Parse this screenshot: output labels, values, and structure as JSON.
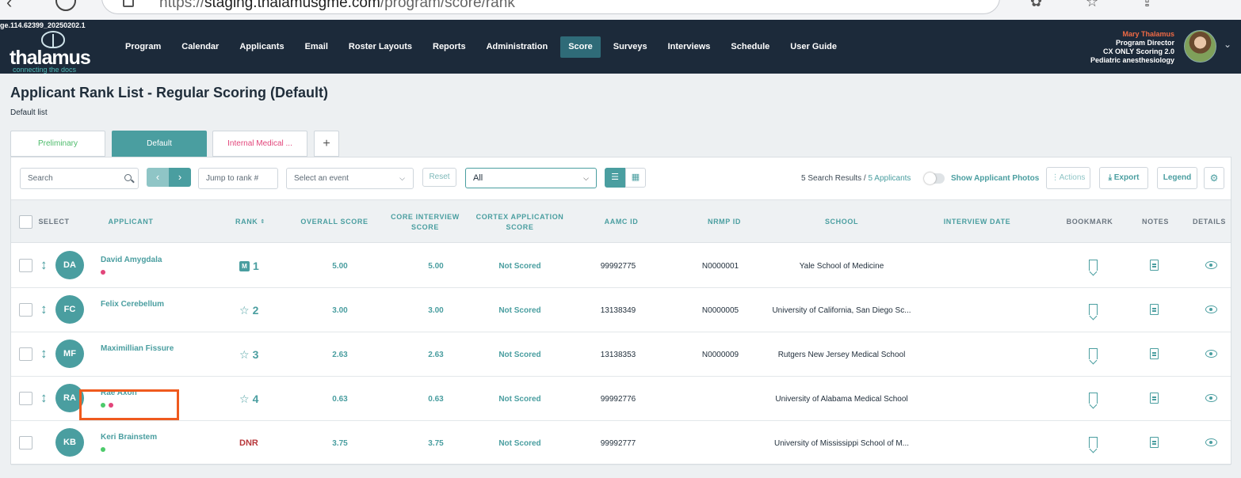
{
  "browser": {
    "url_prefix": "https://",
    "url_domain": "staging.thalamusgme.com",
    "url_path": "/program/score/rank"
  },
  "header": {
    "version": "ge.114.62399_20250202.1",
    "logo_text": "thalamus",
    "logo_tagline": "connecting the docs",
    "nav": [
      "Program",
      "Calendar",
      "Applicants",
      "Email",
      "Roster Layouts",
      "Reports",
      "Administration",
      "Score",
      "Surveys",
      "Interviews",
      "Schedule",
      "User Guide"
    ],
    "active_nav": "Score",
    "user": {
      "name": "Mary Thalamus",
      "role": "Program Director",
      "program": "CX ONLY Scoring 2.0",
      "specialty": "Pediatric anesthesiology"
    }
  },
  "page": {
    "title": "Applicant Rank List - Regular Scoring (Default)",
    "subtitle": "Default list",
    "tabs": [
      {
        "label": "Preliminary"
      },
      {
        "label": "Default"
      },
      {
        "label": "Internal Medical ..."
      }
    ],
    "add_tab_label": "+"
  },
  "toolbar": {
    "search_placeholder": "Search",
    "jump_placeholder": "Jump to rank #",
    "event_placeholder": "Select an event",
    "reset_label": "Reset",
    "filter_value": "All",
    "results_count": "5 Search Results",
    "results_sep": " / ",
    "results_applicants": "5 Applicants",
    "show_photos_label": "Show Applicant Photos",
    "actions_label": "Actions",
    "export_label": "Export",
    "legend_label": "Legend"
  },
  "table": {
    "headers": {
      "select": "SELECT",
      "applicant": "APPLICANT",
      "rank": "RANK",
      "overall": "OVERALL SCORE",
      "core": "CORE INTERVIEW SCORE",
      "cortex": "CORTEX APPLICATION SCORE",
      "aamc": "AAMC ID",
      "nrmp": "NRMP ID",
      "school": "SCHOOL",
      "interview_date": "INTERVIEW DATE",
      "bookmark": "BOOKMARK",
      "notes": "NOTES",
      "details": "DETAILS"
    },
    "rows": [
      {
        "initials": "DA",
        "name": "David Amygdala",
        "dots": [
          "#e2457a"
        ],
        "rank_badge": "M",
        "rank": "1",
        "overall": "5.00",
        "core": "5.00",
        "cortex": "Not Scored",
        "aamc": "99992775",
        "nrmp": "N0000001",
        "school": "Yale School of Medicine"
      },
      {
        "initials": "FC",
        "name": "Felix Cerebellum",
        "dots": [],
        "rank_badge": "star",
        "rank": "2",
        "overall": "3.00",
        "core": "3.00",
        "cortex": "Not Scored",
        "aamc": "13138349",
        "nrmp": "N0000005",
        "school": "University of California, San Diego Sc..."
      },
      {
        "initials": "MF",
        "name": "Maximillian Fissure",
        "dots": [],
        "rank_badge": "star",
        "rank": "3",
        "overall": "2.63",
        "core": "2.63",
        "cortex": "Not Scored",
        "aamc": "13138353",
        "nrmp": "N0000009",
        "school": "Rutgers New Jersey Medical School"
      },
      {
        "initials": "RA",
        "name": "Rae Axon",
        "dots": [
          "#4dca6b",
          "#e2457a"
        ],
        "rank_badge": "star",
        "rank": "4",
        "overall": "0.63",
        "core": "0.63",
        "cortex": "Not Scored",
        "aamc": "99992776",
        "nrmp": "",
        "school": "University of Alabama Medical School"
      },
      {
        "initials": "KB",
        "name": "Keri Brainstem",
        "dots": [
          "#4dca6b"
        ],
        "rank_badge": "none",
        "rank": "DNR",
        "overall": "3.75",
        "core": "3.75",
        "cortex": "Not Scored",
        "aamc": "99992777",
        "nrmp": "",
        "school": "University of Mississippi School of M..."
      }
    ]
  },
  "colors": {
    "accent": "#4a9ea0",
    "header_bg": "#1c2a3a",
    "dnr": "#b8383b",
    "highlight": "#ef5a1e"
  }
}
